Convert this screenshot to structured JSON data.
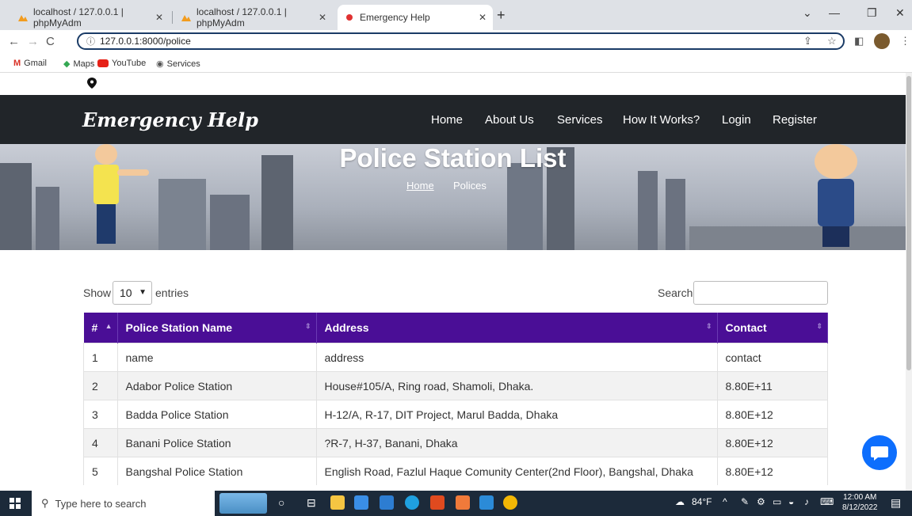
{
  "browser": {
    "tabs": [
      {
        "title": "localhost / 127.0.0.1 | phpMyAdm"
      },
      {
        "title": "localhost / 127.0.0.1 | phpMyAdm"
      },
      {
        "title": "Emergency Help"
      }
    ],
    "url": "127.0.0.1:8000/police",
    "bookmarks": [
      "Gmail",
      "Maps",
      "YouTube",
      "Services"
    ]
  },
  "site": {
    "brand": "Emergency Help",
    "nav": [
      "Home",
      "About Us",
      "Services",
      "How It Works?",
      "Login",
      "Register"
    ],
    "hero_title": "Police Station List",
    "breadcrumb": {
      "home": "Home",
      "current": "Polices"
    }
  },
  "datatable": {
    "show_label": "Show",
    "entries_value": "10",
    "entries_label": "entries",
    "search_label": "Search:",
    "columns": [
      "#",
      "Police Station Name",
      "Address",
      "Contact"
    ],
    "rows": [
      [
        "1",
        "name",
        "address",
        "contact"
      ],
      [
        "2",
        "Adabor Police Station",
        "House#105/A, Ring road, Shamoli, Dhaka.",
        "8.80E+11"
      ],
      [
        "3",
        "Badda Police Station",
        "H-12/A, R-17, DIT Project, Marul Badda, Dhaka",
        "8.80E+12"
      ],
      [
        "4",
        "Banani Police Station",
        "?R-7, H-37, Banani, Dhaka",
        "8.80E+12"
      ],
      [
        "5",
        "Bangshal Police Station",
        "English Road, Fazlul Haque Comunity Center(2nd Floor), Bangshal, Dhaka",
        "8.80E+12"
      ]
    ]
  },
  "taskbar": {
    "search_placeholder": "Type here to search",
    "weather": "84°F",
    "time": "12:00 AM",
    "date": "8/12/2022"
  },
  "colors": {
    "header_bg": "#212529",
    "table_header": "#4a0e96",
    "chat_button": "#0d6efd"
  }
}
